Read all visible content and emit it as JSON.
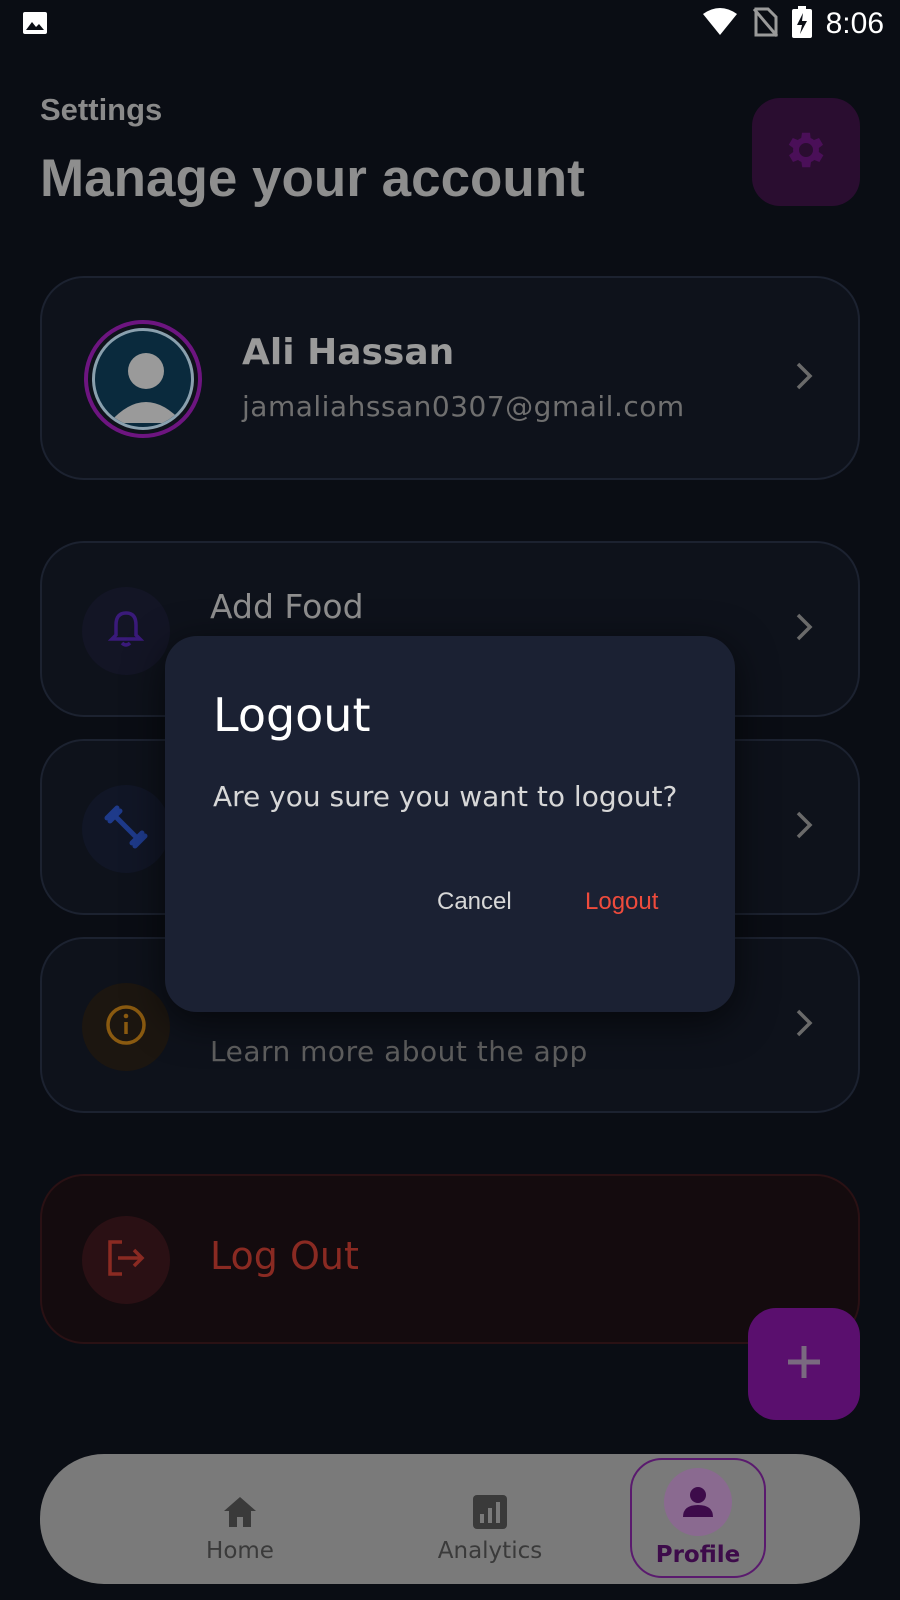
{
  "status_bar": {
    "time": "8:06",
    "icons": [
      "image-icon",
      "wifi-icon",
      "no-sim-icon",
      "battery-charging-icon"
    ]
  },
  "header": {
    "subtitle": "Settings",
    "title": "Manage your account",
    "settings_icon": "gear-icon"
  },
  "profile": {
    "name": "Ali Hassan",
    "email": "jamaliahssan0307@gmail.com"
  },
  "settings_items": [
    {
      "title": "Add Food",
      "subtitle": "",
      "icon": "bell-icon"
    },
    {
      "title": "",
      "subtitle": "",
      "icon": "dumbbell-icon"
    },
    {
      "title": "",
      "subtitle": "Learn more about the app",
      "icon": "info-icon"
    }
  ],
  "logout_item": {
    "title": "Log Out",
    "icon": "logout-icon"
  },
  "dialog": {
    "title": "Logout",
    "message": "Are you sure you want to logout?",
    "cancel_label": "Cancel",
    "confirm_label": "Logout"
  },
  "fab": {
    "icon": "plus-icon"
  },
  "bottom_nav": {
    "items": [
      {
        "label": "Home",
        "icon": "home-icon"
      },
      {
        "label": "Analytics",
        "icon": "analytics-icon"
      },
      {
        "label": "Profile",
        "icon": "person-icon",
        "active": true
      }
    ]
  },
  "colors": {
    "accent": "#7a1a8f",
    "danger": "#ef4b3c",
    "dialog_bg": "#1b2133",
    "bg": "#0a0d14"
  }
}
